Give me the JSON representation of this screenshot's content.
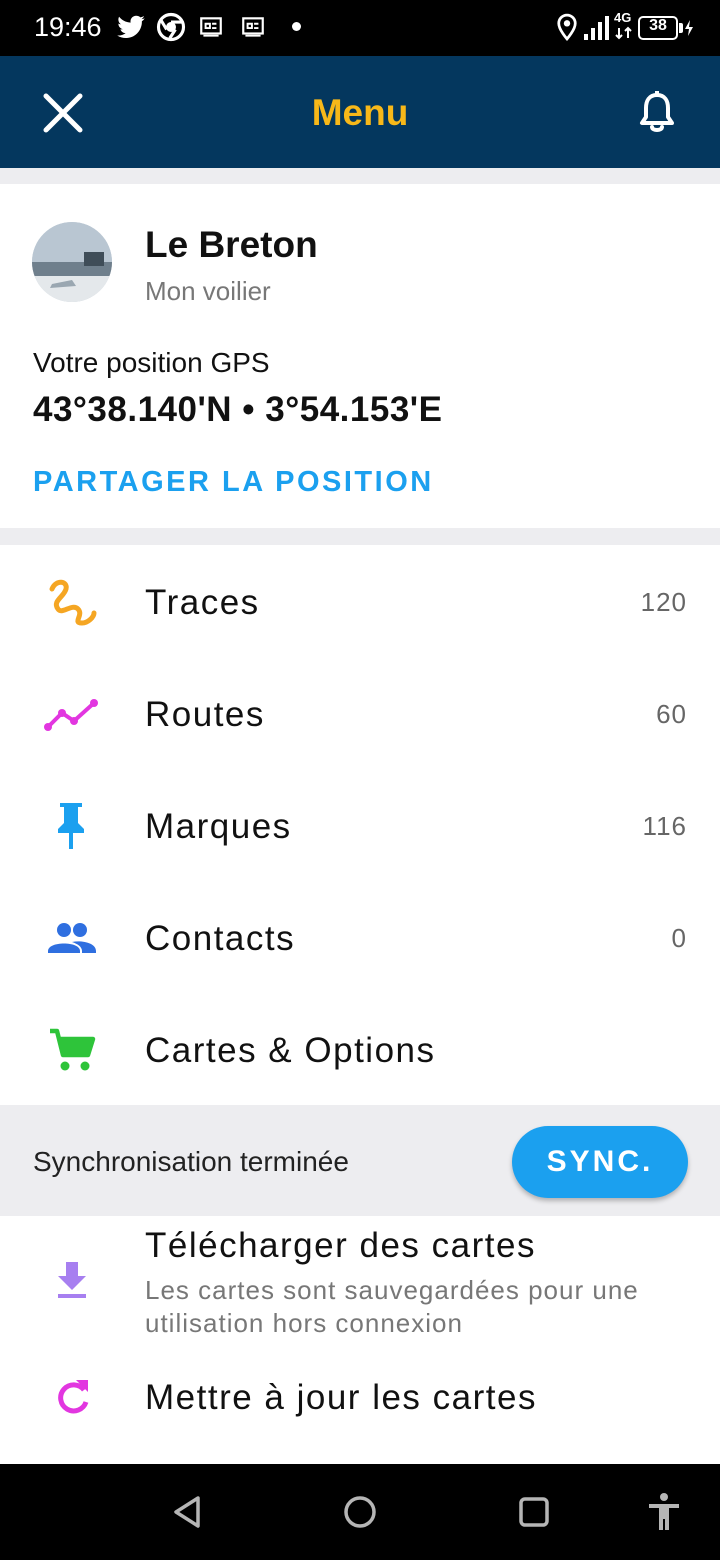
{
  "status_bar": {
    "time": "19:46",
    "icons": [
      "twitter-icon",
      "chrome-icon",
      "notification-icon",
      "notification-icon"
    ],
    "network": "4G",
    "battery": "38"
  },
  "app_bar": {
    "title": "Menu",
    "close_icon": "close-icon",
    "bell_icon": "bell-icon"
  },
  "profile": {
    "name": "Le Breton",
    "subtitle": "Mon voilier",
    "gps_label": "Votre position GPS",
    "gps_value": "43°38.140'N • 3°54.153'E",
    "share_label": "PARTAGER LA POSITION"
  },
  "menu": {
    "items": [
      {
        "label": "Traces",
        "count": "120",
        "icon": "traces-icon",
        "color": "#f5a623"
      },
      {
        "label": "Routes",
        "count": "60",
        "icon": "routes-icon",
        "color": "#e236e0"
      },
      {
        "label": "Marques",
        "count": "116",
        "icon": "pin-icon",
        "color": "#1ba0ef"
      },
      {
        "label": "Contacts",
        "count": "0",
        "icon": "contacts-icon",
        "color": "#2f6fe0"
      },
      {
        "label": "Cartes & Options",
        "count": "",
        "icon": "cart-icon",
        "color": "#2ec43a"
      }
    ]
  },
  "sync": {
    "status_text": "Synchronisation terminée",
    "button_label": "SYNC."
  },
  "downloads": {
    "download_title": "Télécharger des cartes",
    "download_sub": "Les cartes sont sauvegardées pour une utilisation hors connexion",
    "update_title": "Mettre à jour les cartes"
  },
  "colors": {
    "app_bar_bg": "#04375e",
    "title_color": "#f8b819",
    "accent": "#1ba0ef"
  }
}
